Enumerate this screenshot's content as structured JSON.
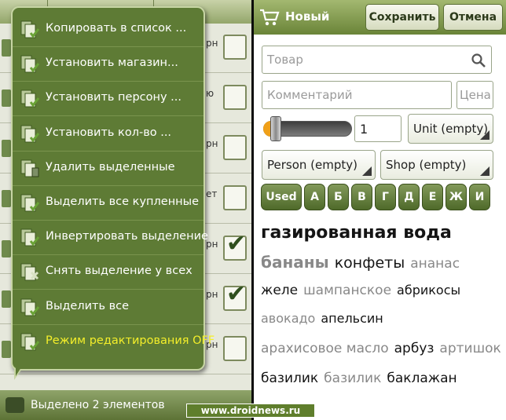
{
  "left_screen": {
    "background_rows": [
      {
        "side_text": "рн",
        "checked": false
      },
      {
        "side_text": "ю",
        "checked": false
      },
      {
        "side_text": "рн",
        "checked": false
      },
      {
        "side_text": "ет",
        "checked": false
      },
      {
        "side_text": "рн",
        "checked": true
      },
      {
        "side_text": "рн",
        "checked": true
      },
      {
        "side_text": "рн",
        "checked": false
      }
    ],
    "context_menu": [
      {
        "label": "Копировать в список ...",
        "icon": "copy-list-icon"
      },
      {
        "label": "Установить магазин...",
        "icon": "store-check-icon"
      },
      {
        "label": "Установить персону ...",
        "icon": "person-check-icon"
      },
      {
        "label": "Установить кол-во ...",
        "icon": "quantity-box-icon"
      },
      {
        "label": "Удалить выделенные",
        "icon": "delete-selected-icon"
      },
      {
        "label": "Выделить все купленные",
        "icon": "select-bought-icon"
      },
      {
        "label": "Инвертировать выделение",
        "icon": "invert-selection-icon"
      },
      {
        "label": "Снять выделение у всех",
        "icon": "clear-selection-icon"
      },
      {
        "label": "Выделить все",
        "icon": "select-all-icon"
      },
      {
        "label": "Режим редактирования OFF",
        "icon": "edit-mode-icon",
        "highlight": true
      }
    ],
    "status_text": "Выделено 2 элементов"
  },
  "right_screen": {
    "title": "Новый",
    "save_label": "Сохранить",
    "cancel_label": "Отмена",
    "item_placeholder": "Товар",
    "comment_placeholder": "Комментарий",
    "price_placeholder": "Цена",
    "quantity_value": "1",
    "unit_spinner": "Unit (empty)",
    "person_spinner": "Person (empty)",
    "shop_spinner": "Shop (empty)",
    "alphabet_tabs": [
      "Used",
      "А",
      "Б",
      "В",
      "Г",
      "Д",
      "Е",
      "Ж",
      "И"
    ],
    "tag_cloud": [
      [
        {
          "text": "газированная вода",
          "size": 22,
          "bold": true,
          "color": "dark"
        }
      ],
      [
        {
          "text": "бананы",
          "size": 20,
          "bold": true,
          "color": "gray"
        },
        {
          "text": "конфеты",
          "size": 19,
          "bold": false,
          "color": "dark"
        },
        {
          "text": "ананас",
          "size": 17,
          "bold": false,
          "color": "gray"
        }
      ],
      [
        {
          "text": "желе",
          "size": 17,
          "bold": false,
          "color": "dark"
        },
        {
          "text": "шампанское",
          "size": 17,
          "bold": false,
          "color": "gray"
        },
        {
          "text": "абрикосы",
          "size": 16,
          "bold": false,
          "color": "dark"
        }
      ],
      [
        {
          "text": "авокадо",
          "size": 16,
          "bold": false,
          "color": "gray"
        },
        {
          "text": "апельсин",
          "size": 16,
          "bold": false,
          "color": "dark"
        }
      ],
      [
        {
          "text": "арахисовое масло",
          "size": 17,
          "bold": false,
          "color": "gray"
        },
        {
          "text": "арбуз",
          "size": 17,
          "bold": false,
          "color": "dark"
        },
        {
          "text": "артишок",
          "size": 17,
          "bold": false,
          "color": "gray"
        }
      ],
      [
        {
          "text": "базилик",
          "size": 17,
          "bold": false,
          "color": "dark"
        },
        {
          "text": "базилик",
          "size": 17,
          "bold": false,
          "color": "gray"
        },
        {
          "text": "баклажан",
          "size": 17,
          "bold": false,
          "color": "dark"
        }
      ]
    ]
  },
  "watermark": "www.droidnews.ru",
  "colors": {
    "menu_bg": "#5e7b35",
    "accent_yellow": "#f4ee2a",
    "titlebar": "#6a8438"
  }
}
